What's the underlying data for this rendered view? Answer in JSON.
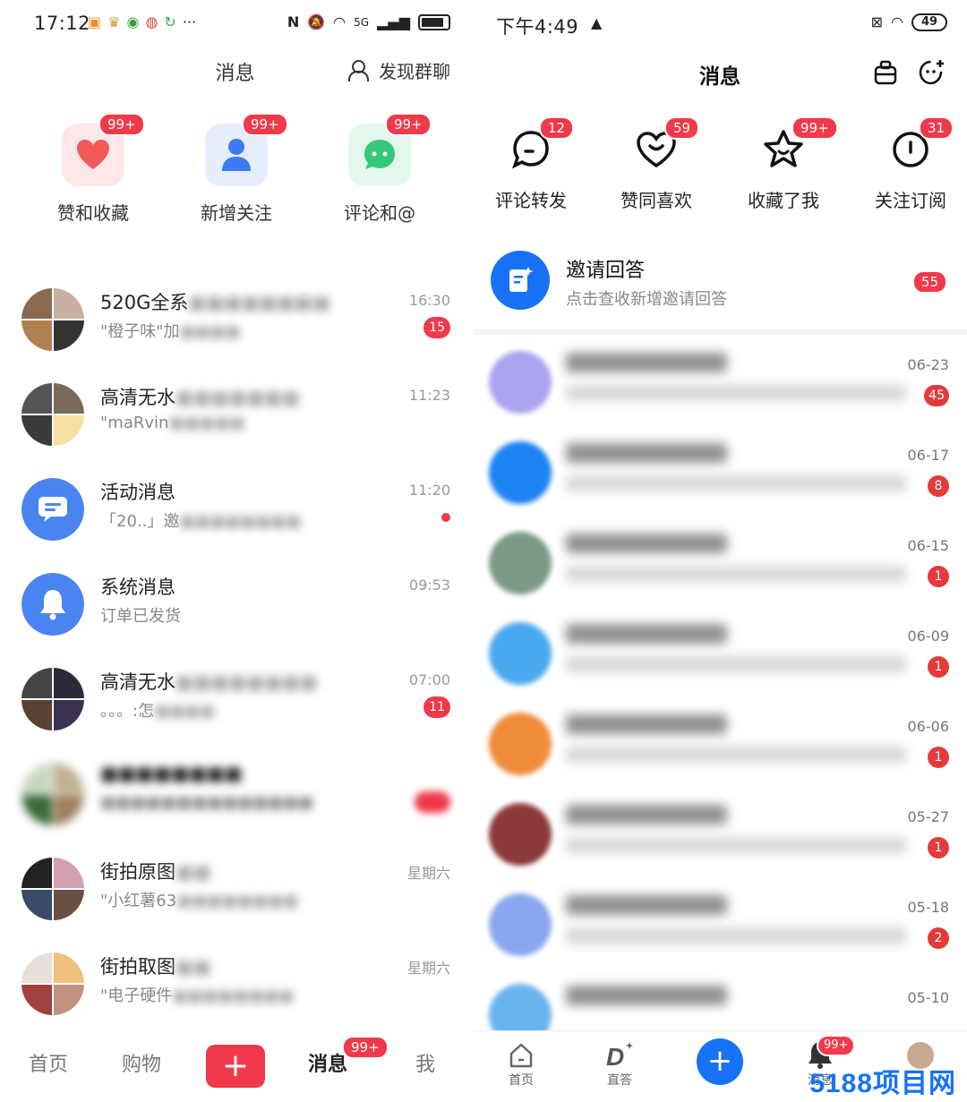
{
  "left": {
    "status": {
      "time": "17:12",
      "notif_more": "···",
      "net": "5G"
    },
    "header": {
      "title": "消息",
      "discover": "发现群聊"
    },
    "shortcuts": [
      {
        "label": "赞和收藏",
        "badge": "99+",
        "color": "#f36c6c"
      },
      {
        "label": "新增关注",
        "badge": "99+",
        "color": "#3c7bf0"
      },
      {
        "label": "评论和@",
        "badge": "99+",
        "color": "#36c97a"
      }
    ],
    "conversations": [
      {
        "name": "520G全系",
        "preview": "\"橙子味\"加",
        "time": "16:30",
        "count": "15"
      },
      {
        "name": "高清无水",
        "preview": "\"maRvin",
        "time": "11:23"
      },
      {
        "name": "活动消息",
        "preview": "「20..」邀",
        "time": "11:20",
        "dot": true
      },
      {
        "name": "系统消息",
        "preview": "订单已发货",
        "time": "09:53"
      },
      {
        "name": "高清无水",
        "preview": "。。。:怎",
        "time": "07:00",
        "count": "11"
      },
      {
        "name": "",
        "preview": "",
        "time": ""
      },
      {
        "name": "街拍原图",
        "preview": "\"小红薯63",
        "time": "星期六"
      },
      {
        "name": "街拍取图",
        "preview": "\"电子硬件",
        "time": "星期六"
      }
    ],
    "nav": {
      "home": "首页",
      "shop": "购物",
      "plus": "+",
      "messages": "消息",
      "messages_badge": "99+",
      "me": "我"
    }
  },
  "right": {
    "status": {
      "time": "下午4:49",
      "battery": "49"
    },
    "header": {
      "title": "消息"
    },
    "shortcuts": [
      {
        "label": "评论转发",
        "badge": "12"
      },
      {
        "label": "赞同喜欢",
        "badge": "59"
      },
      {
        "label": "收藏了我",
        "badge": "99+"
      },
      {
        "label": "关注订阅",
        "badge": "31"
      }
    ],
    "invite": {
      "title": "邀请回答",
      "subtitle": "点击查收新增邀请回答",
      "count": "55"
    },
    "conversations": [
      {
        "time": "06-23",
        "count": "45",
        "color": "#a9a3f0"
      },
      {
        "time": "06-17",
        "count": "8",
        "color": "#1d82f2"
      },
      {
        "time": "06-15",
        "count": "1",
        "color": "#7a9a86"
      },
      {
        "time": "06-09",
        "count": "1",
        "color": "#4aa8ee"
      },
      {
        "time": "06-06",
        "count": "1",
        "color": "#f08c3a"
      },
      {
        "time": "05-27",
        "count": "1",
        "color": "#8a3a3a"
      },
      {
        "time": "05-18",
        "count": "2",
        "color": "#8aa6ee"
      },
      {
        "time": "05-10",
        "count": "",
        "color": "#6ab4ee"
      }
    ],
    "nav": {
      "home": "首页",
      "zhida": "直答",
      "plus": "+",
      "messages": "消息",
      "messages_badge": "99+"
    },
    "watermark": "5188项目网"
  }
}
